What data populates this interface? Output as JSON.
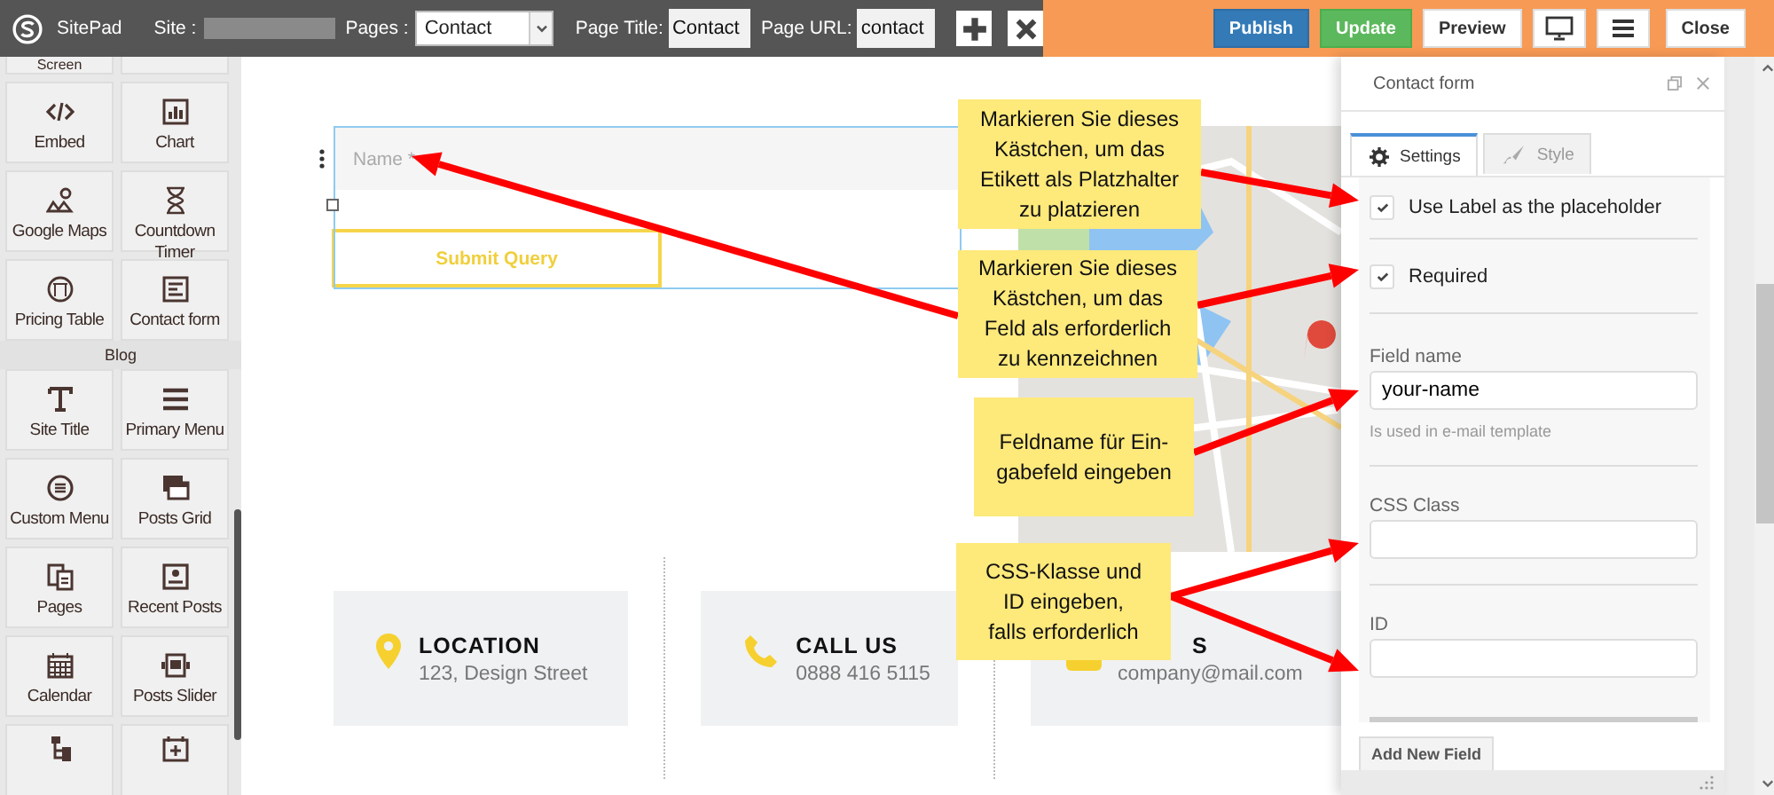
{
  "topbar": {
    "brand": "SitePad",
    "site_label": "Site :",
    "pages_label": "Pages :",
    "page_select": "Contact",
    "page_title_label": "Page Title:",
    "page_title": "Contact",
    "page_url_label": "Page URL:",
    "page_url": "contact",
    "actions": [
      {
        "kind": "primary",
        "label": "Publish"
      },
      {
        "kind": "success",
        "label": "Update"
      },
      {
        "kind": "plain",
        "label": "Preview"
      },
      {
        "kind": "desktop"
      },
      {
        "kind": "menu"
      },
      {
        "kind": "plain",
        "label": "Close"
      }
    ]
  },
  "sidebar": {
    "partial_label": "Screen",
    "widgets": [
      "Embed",
      "Chart",
      "Google Maps",
      "Countdown Timer",
      "Pricing Table",
      "Contact form"
    ],
    "section": "Blog",
    "blog_widgets": [
      "Site Title",
      "Primary Menu",
      "Custom Menu",
      "Posts Grid",
      "Pages",
      "Recent Posts",
      "Calendar",
      "Posts Slider"
    ]
  },
  "canvas": {
    "name_placeholder": "Name *",
    "submit": "Submit Query",
    "cards": [
      {
        "kind": "location",
        "title": "LOCATION",
        "text": "123, Design Street"
      },
      {
        "kind": "phone",
        "title": "CALL US",
        "text": "0888 416 5115"
      },
      {
        "kind": "email",
        "title": "S",
        "text": "company@mail.com"
      }
    ]
  },
  "panel": {
    "title": "Contact form",
    "tabs": [
      {
        "label": "Settings",
        "selected": true
      },
      {
        "label": "Style",
        "selected": false
      }
    ],
    "checks": [
      {
        "label": "Use Label as the placeholder",
        "checked": true
      },
      {
        "label": "Required",
        "checked": true
      }
    ],
    "fields": [
      {
        "label": "Field name",
        "value": "your-name",
        "hint": "Is used in e-mail template"
      },
      {
        "label": "CSS Class"
      },
      {
        "label": "ID"
      }
    ],
    "add_button": "Add New Field"
  },
  "callouts": [
    "Markieren Sie dieses\nKästchen, um das\nEtikett als Platzhalter\nzu platzieren",
    "Markieren Sie dieses\nKästchen, um das\nFeld als erforderlich\nzu kennzeichnen",
    "Feldname für Ein-\ngabefeld eingeben",
    "CSS-Klasse und\nID eingeben,\nfalls erforderlich"
  ]
}
